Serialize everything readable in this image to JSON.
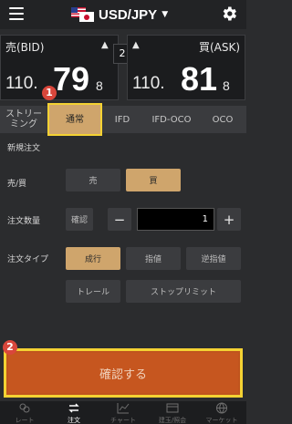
{
  "header": {
    "pair": "USD/JPY",
    "caret": "▼"
  },
  "bid": {
    "label": "売(BID)",
    "arrow": "▲",
    "prefix": "110.",
    "big": "79",
    "pip": "8"
  },
  "ask": {
    "label": "買(ASK)",
    "arrow": "▲",
    "prefix": "110.",
    "big": "81",
    "pip": "8"
  },
  "spread": "2",
  "tabs": [
    {
      "label": "ストリーミング"
    },
    {
      "label": "通常"
    },
    {
      "label": "IFD"
    },
    {
      "label": "IFD-OCO"
    },
    {
      "label": "OCO"
    }
  ],
  "annotations": {
    "one": "1",
    "two": "2"
  },
  "form": {
    "section": "新規注文",
    "side_label": "売/買",
    "sell": "売",
    "buy": "買",
    "qty_label": "注文数量",
    "qty_confirm": "確認",
    "minus": "−",
    "qty_value": "1",
    "plus": "+",
    "type_label": "注文タイプ",
    "types": [
      "成行",
      "指値",
      "逆指値",
      "トレール",
      "ストップリミット"
    ]
  },
  "confirm_button": "確認する",
  "nav": [
    {
      "label": "レート"
    },
    {
      "label": "注文"
    },
    {
      "label": "チャート"
    },
    {
      "label": "建玉/照会"
    },
    {
      "label": "マーケット"
    }
  ]
}
